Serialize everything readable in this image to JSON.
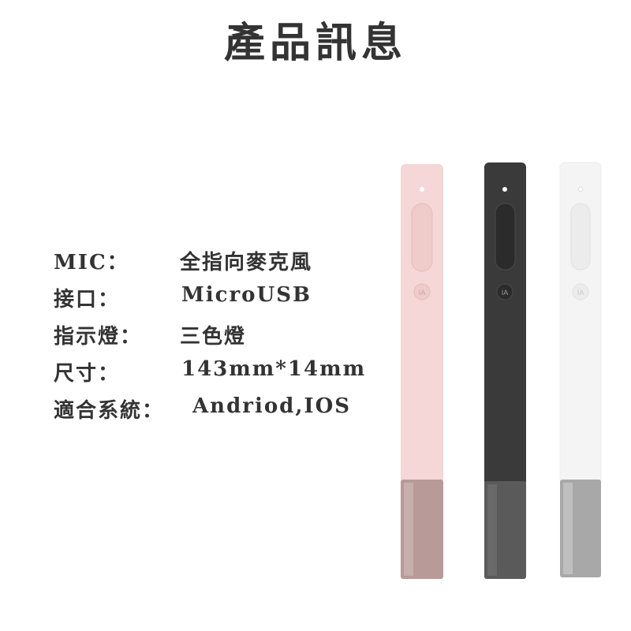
{
  "title": "產品訊息",
  "specs": [
    {
      "label": "MIC：",
      "value": "全指向麥克風"
    },
    {
      "label": "接口：",
      "value": "MicroUSB"
    },
    {
      "label": "指示燈：",
      "value": "三色燈"
    },
    {
      "label": "尺寸：",
      "value": "143mm*14mm"
    },
    {
      "label": "適合系統：",
      "value": "Andriod,IOS"
    }
  ],
  "products": [
    {
      "name": "pink-pen",
      "body_color": "#f4d7d6",
      "tip_color": "#b89a98",
      "button_label": "IA"
    },
    {
      "name": "black-pen",
      "body_color": "#3a3a3a",
      "tip_color": "#5a5a5a",
      "button_label": "IA"
    },
    {
      "name": "white-pen",
      "body_color": "#f4f4f4",
      "tip_color": "#a8a8a8",
      "button_label": "IA"
    }
  ]
}
